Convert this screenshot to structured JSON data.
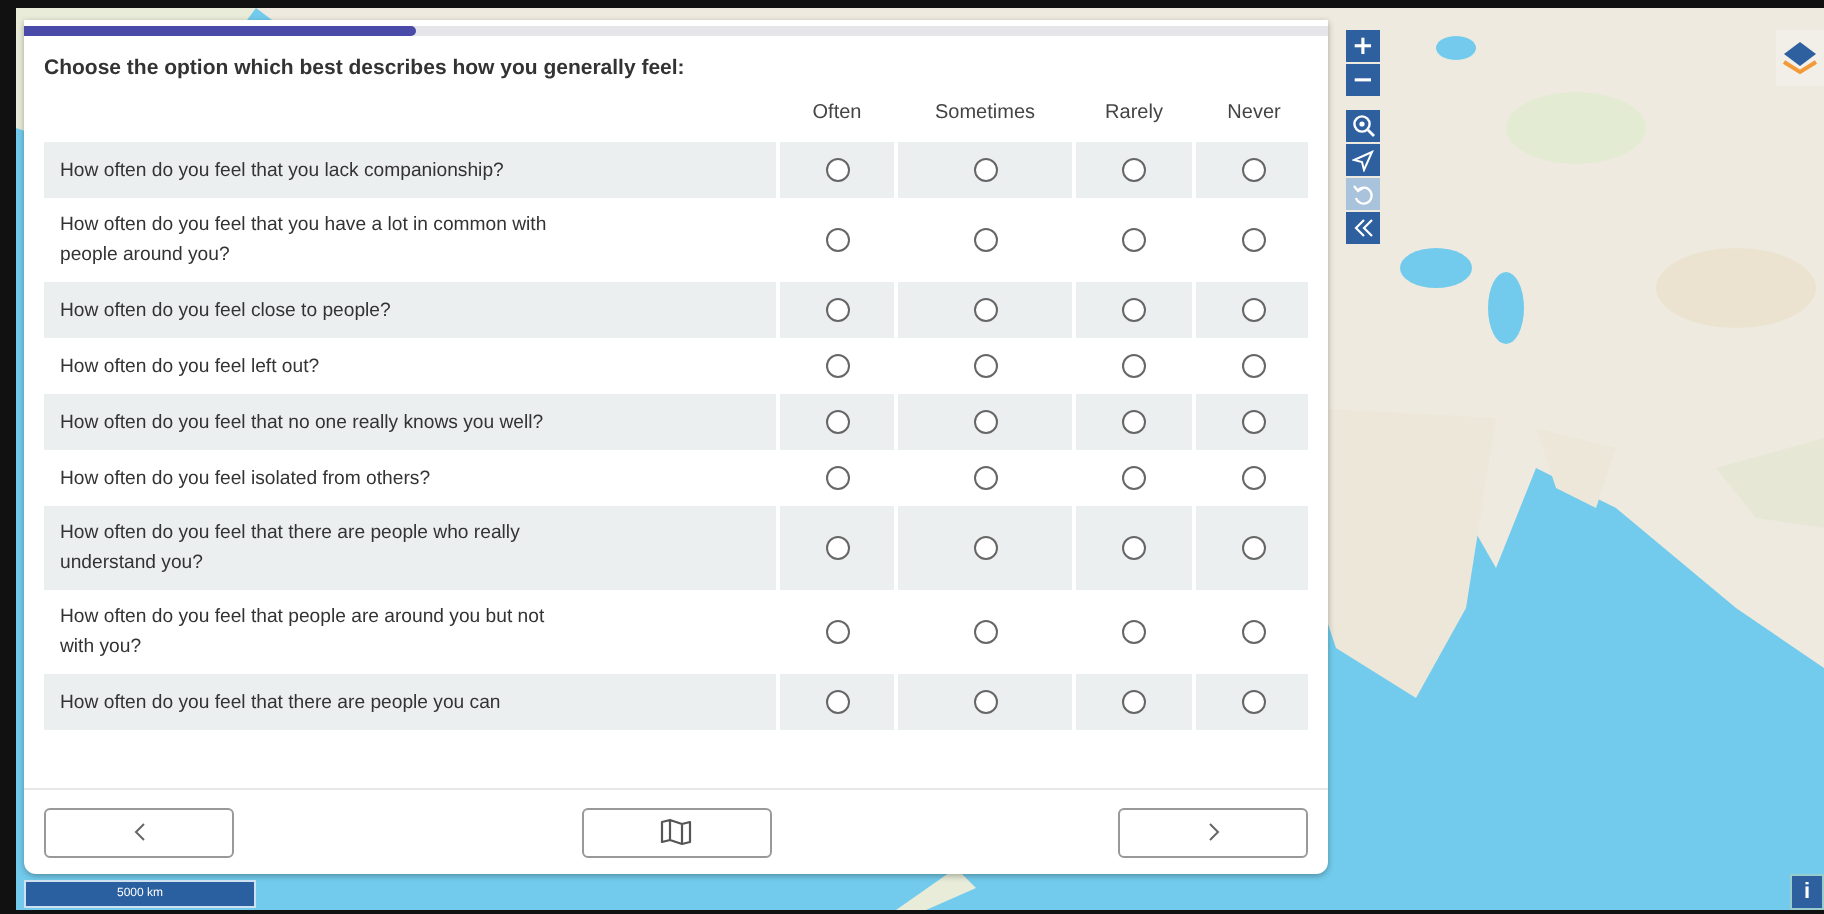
{
  "survey": {
    "progress": {
      "level": 0.3
    },
    "prompt": "Choose the option which best describes how you generally feel:",
    "columns": [
      "Often",
      "Sometimes",
      "Rarely",
      "Never"
    ],
    "rows": [
      {
        "question": "How often do you feel that you lack companionship?",
        "choices": [
          {
            "selected": false
          },
          {
            "selected": false
          },
          {
            "selected": false
          },
          {
            "selected": false
          }
        ]
      },
      {
        "question": "How often do you feel that you have a lot in common with people around you?",
        "choices": [
          {
            "selected": false
          },
          {
            "selected": false
          },
          {
            "selected": false
          },
          {
            "selected": false
          }
        ]
      },
      {
        "question": "How often do you feel close to people?",
        "choices": [
          {
            "selected": false
          },
          {
            "selected": false
          },
          {
            "selected": false
          },
          {
            "selected": false
          }
        ]
      },
      {
        "question": "How often do you feel left out?",
        "choices": [
          {
            "selected": false
          },
          {
            "selected": false
          },
          {
            "selected": false
          },
          {
            "selected": false
          }
        ]
      },
      {
        "question": "How often do you feel that no one really knows you well?",
        "choices": [
          {
            "selected": false
          },
          {
            "selected": false
          },
          {
            "selected": false
          },
          {
            "selected": false
          }
        ]
      },
      {
        "question": "How often do you feel isolated from others?",
        "choices": [
          {
            "selected": false
          },
          {
            "selected": false
          },
          {
            "selected": false
          },
          {
            "selected": false
          }
        ]
      },
      {
        "question": "How often do you feel that there are people who really understand you?",
        "choices": [
          {
            "selected": false
          },
          {
            "selected": false
          },
          {
            "selected": false
          },
          {
            "selected": false
          }
        ]
      },
      {
        "question": "How often do you feel that people are around you but not with you?",
        "choices": [
          {
            "selected": false
          },
          {
            "selected": false
          },
          {
            "selected": false
          },
          {
            "selected": false
          }
        ]
      },
      {
        "question": "How often do you feel that there are people you can",
        "choices": [
          {
            "selected": false
          },
          {
            "selected": false
          },
          {
            "selected": false
          },
          {
            "selected": false
          }
        ]
      }
    ],
    "nav_buttons": [
      {
        "kind": "previous"
      },
      {
        "kind": "map"
      },
      {
        "kind": "next"
      }
    ]
  },
  "map": {
    "kind": "picture",
    "controls": [
      {
        "kind": "zoom-in",
        "label": "+",
        "disabled": false
      },
      {
        "kind": "zoom-out",
        "label": "−",
        "disabled": false
      },
      {
        "kind": "search",
        "disabled": false
      },
      {
        "kind": "locate",
        "disabled": false
      },
      {
        "kind": "undo",
        "disabled": true
      },
      {
        "kind": "collapse",
        "disabled": false
      }
    ],
    "scale": "5000 km",
    "info": "i"
  }
}
